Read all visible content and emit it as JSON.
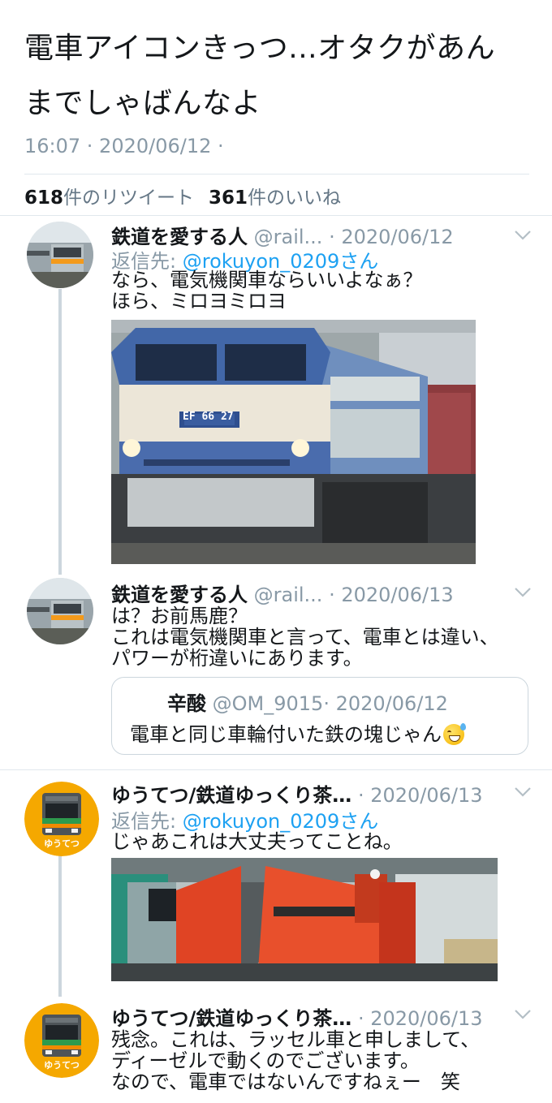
{
  "main_tweet": {
    "text_line1": "電車アイコンきっつ...オタクがあん",
    "text_line2": "までしゃばんなよ",
    "time": "16:07 · 2020/06/12 ·"
  },
  "stats": {
    "retweets_count": "618",
    "retweets_label": "件のリツイート",
    "likes_count": "361",
    "likes_label": "件のいいね"
  },
  "replies": [
    {
      "name": "鉄道を愛する人",
      "handle": "@rail...",
      "date": "· 2020/06/12",
      "reply_prefix": "返信先:",
      "reply_to": "@rokuyon_0209さん",
      "text": "なら、電気機関車ならいいよなぁ？\nほら、ミロヨミロヨ",
      "image_label": "EF 66 27"
    },
    {
      "name": "鉄道を愛する人",
      "handle": "@rail...",
      "date": "· 2020/06/13",
      "text": "は？お前馬鹿？\nこれは電気機関車と言って、電車とは違い、\nパワーが桁違いにあります。",
      "quote": {
        "name": "辛酸",
        "handle": "@OM_9015",
        "date": "· 2020/06/12",
        "text": "電車と同じ車輪付いた鉄の塊じゃん"
      }
    },
    {
      "name": "ゆうてつ/鉄道ゆっくり茶…",
      "date": "· 2020/06/13",
      "reply_prefix": "返信先:",
      "reply_to": "@rokuyon_0209さん",
      "text": "じゃあこれは大丈夫ってことね。"
    },
    {
      "name": "ゆうてつ/鉄道ゆっくり茶…",
      "date": "· 2020/06/13",
      "text": "残念。これは、ラッセル車と申しまして、\nディーゼルで動くのでございます。\nなので、電車ではないんですねぇー　笑"
    }
  ],
  "avatar_text": "ゆうてつ",
  "colors": {
    "accent": "#1da1f2",
    "secondary_text": "#8899a6",
    "divider": "#e1e8ed",
    "avatar_orange": "#f5a800"
  }
}
